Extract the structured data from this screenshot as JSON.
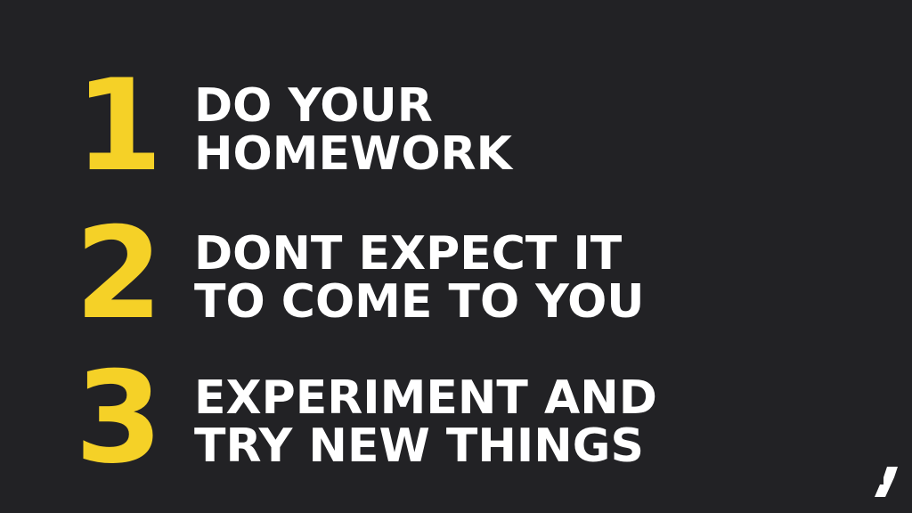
{
  "slide": {
    "items": [
      {
        "number": "1",
        "lines": [
          "DO YOUR",
          "HOMEWORK"
        ]
      },
      {
        "number": "2",
        "lines": [
          "DONT EXPECT IT",
          "TO COME TO YOU"
        ]
      },
      {
        "number": "3",
        "lines": [
          "EXPERIMENT AND",
          "TRY NEW THINGS"
        ]
      }
    ]
  },
  "colors": {
    "background": "#222225",
    "accent": "#f5d127",
    "text": "#ffffff"
  },
  "logo": {
    "icon": "brand-logo-icon"
  }
}
